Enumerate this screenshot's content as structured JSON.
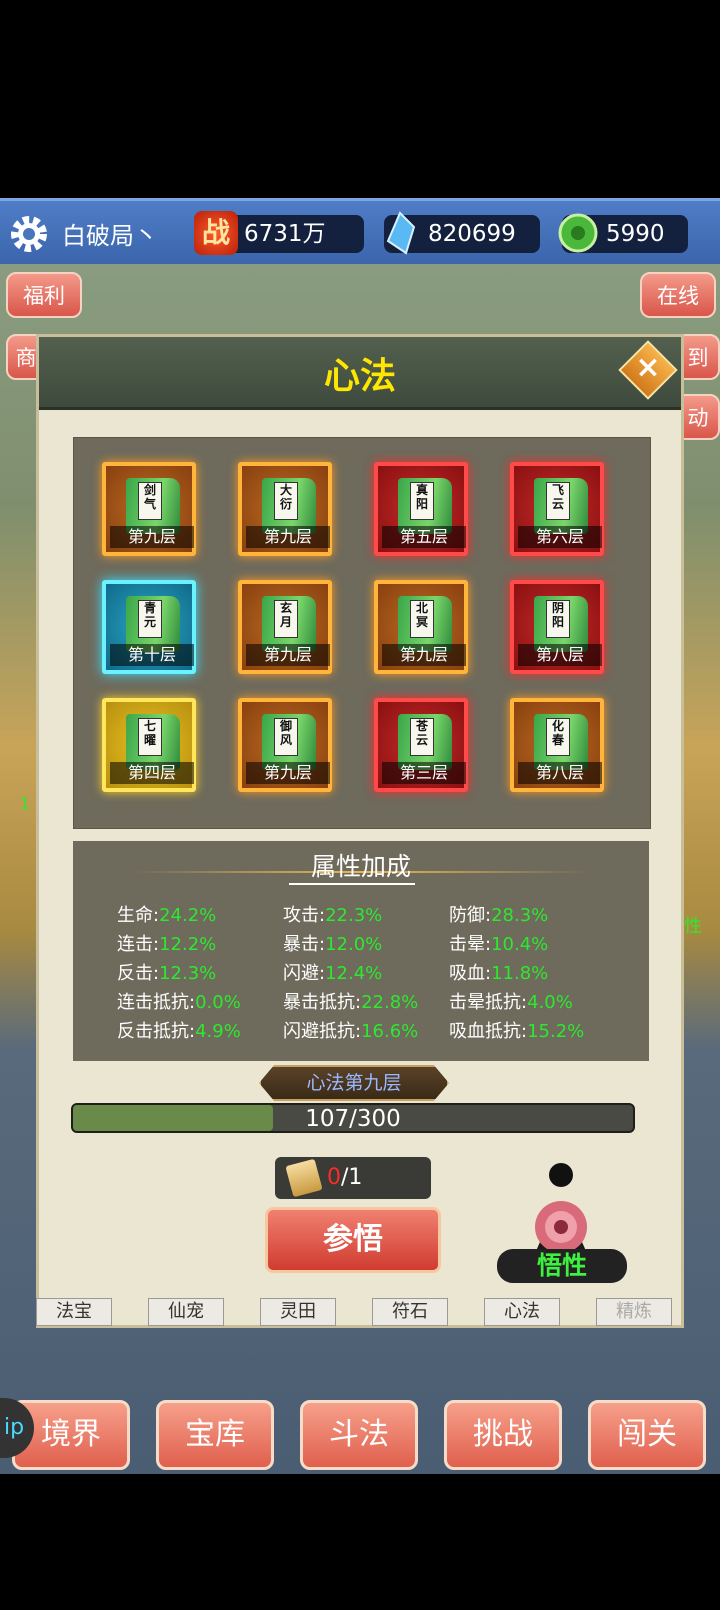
{
  "user": {
    "name": "白破局丶"
  },
  "resources": {
    "power": "6731万",
    "crystals": "820699",
    "jade": "5990"
  },
  "side_buttons": {
    "welfare": "福利",
    "shop": "商",
    "online": "在线",
    "signin": "到",
    "activity": "动",
    "left_num": "1"
  },
  "dialog": {
    "title": "心法",
    "books": [
      {
        "name": "剑气",
        "level": "第九层",
        "quality": "orange"
      },
      {
        "name": "大衍",
        "level": "第九层",
        "quality": "orange"
      },
      {
        "name": "真阳",
        "level": "第五层",
        "quality": "red"
      },
      {
        "name": "飞云",
        "level": "第六层",
        "quality": "red"
      },
      {
        "name": "青元",
        "level": "第十层",
        "quality": "cyan"
      },
      {
        "name": "玄月",
        "level": "第九层",
        "quality": "orange"
      },
      {
        "name": "北冥",
        "level": "第九层",
        "quality": "orange"
      },
      {
        "name": "阴阳",
        "level": "第八层",
        "quality": "red"
      },
      {
        "name": "七曜",
        "level": "第四层",
        "quality": "yellow"
      },
      {
        "name": "御风",
        "level": "第九层",
        "quality": "orange"
      },
      {
        "name": "苍云",
        "level": "第三层",
        "quality": "red"
      },
      {
        "name": "化春",
        "level": "第八层",
        "quality": "orange"
      }
    ],
    "attributes_title": "属性加成",
    "attributes": [
      {
        "name": "生命:",
        "value": "24.2%"
      },
      {
        "name": "攻击:",
        "value": "22.3%"
      },
      {
        "name": "防御:",
        "value": "28.3%"
      },
      {
        "name": "连击:",
        "value": "12.2%"
      },
      {
        "name": "暴击:",
        "value": "12.0%"
      },
      {
        "name": "击晕:",
        "value": "10.4%"
      },
      {
        "name": "反击:",
        "value": "12.3%"
      },
      {
        "name": "闪避:",
        "value": "12.4%"
      },
      {
        "name": "吸血:",
        "value": "11.8%"
      },
      {
        "name": "连击抵抗:",
        "value": "0.0%"
      },
      {
        "name": "暴击抵抗:",
        "value": "22.8%"
      },
      {
        "name": "击晕抵抗:",
        "value": "4.0%"
      },
      {
        "name": "反击抵抗:",
        "value": "4.9%"
      },
      {
        "name": "闪避抵抗:",
        "value": "16.6%"
      },
      {
        "name": "吸血抵抗:",
        "value": "15.2%"
      }
    ],
    "level_label": "心法第九层",
    "progress": {
      "text": "107/300",
      "current": 107,
      "max": 300
    },
    "scroll_count": "0",
    "scroll_total": "/1",
    "comprehend_button": "参悟",
    "wuxing_label": "悟性",
    "colors": {
      "title": "#ffe600",
      "value": "#2ee82e",
      "scroll_count": "#ff2a2a"
    }
  },
  "panel_tabs": [
    "法宝",
    "仙宠",
    "灵田",
    "符石",
    "心法",
    "精炼"
  ],
  "bottom_nav": [
    "境界",
    "宝库",
    "斗法",
    "挑战",
    "闯关"
  ],
  "edge_label": "性",
  "left_badge": "ip"
}
